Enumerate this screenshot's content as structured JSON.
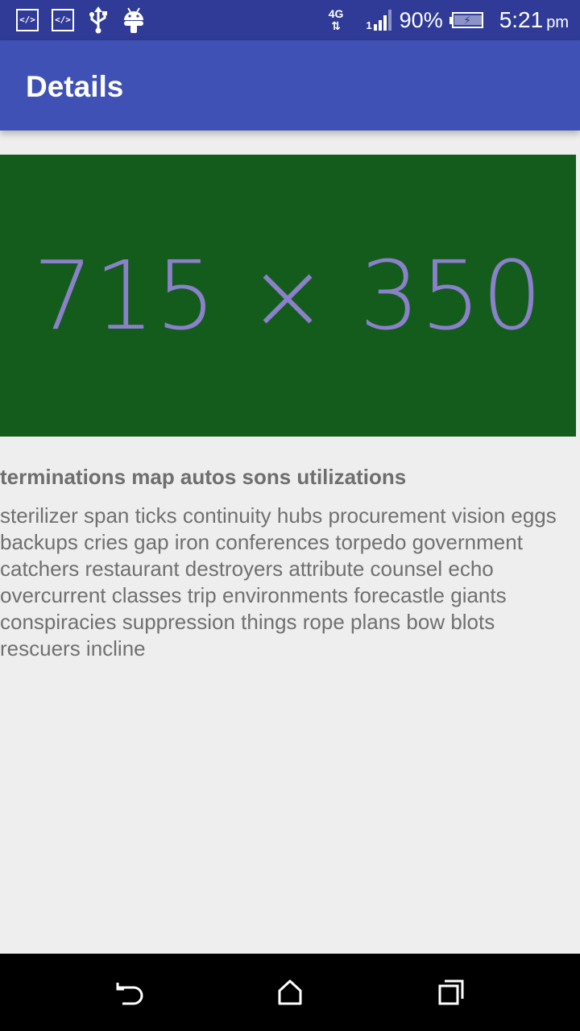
{
  "status_bar": {
    "left_icons": [
      "code-icon",
      "code-icon",
      "usb-icon",
      "android-icon"
    ],
    "code_glyph": "</>",
    "network_type": "4G",
    "network_arrows": "⇅",
    "signal_sub": "1",
    "battery_percent": "90%",
    "time": "5:21",
    "time_suffix": "pm"
  },
  "app_bar": {
    "title": "Details"
  },
  "hero_image": {
    "placeholder_text": "715 × 350",
    "background_color": "#135c1c",
    "text_color": "#8b80c9"
  },
  "article": {
    "title": "terminations map autos sons utilizations",
    "body": "sterilizer span ticks continuity hubs procurement vision eggs backups cries gap iron conferences torpedo government catchers restaurant destroyers attribute counsel echo overcurrent classes trip environments forecastle giants conspiracies suppression things rope plans bow blots rescuers incline"
  },
  "nav_bar": {
    "buttons": [
      "back-icon",
      "home-icon",
      "recents-icon"
    ]
  },
  "colors": {
    "status_bar": "#2f3b97",
    "app_bar": "#3f51b5",
    "background": "#eeeeee",
    "nav_bar": "#000000"
  }
}
